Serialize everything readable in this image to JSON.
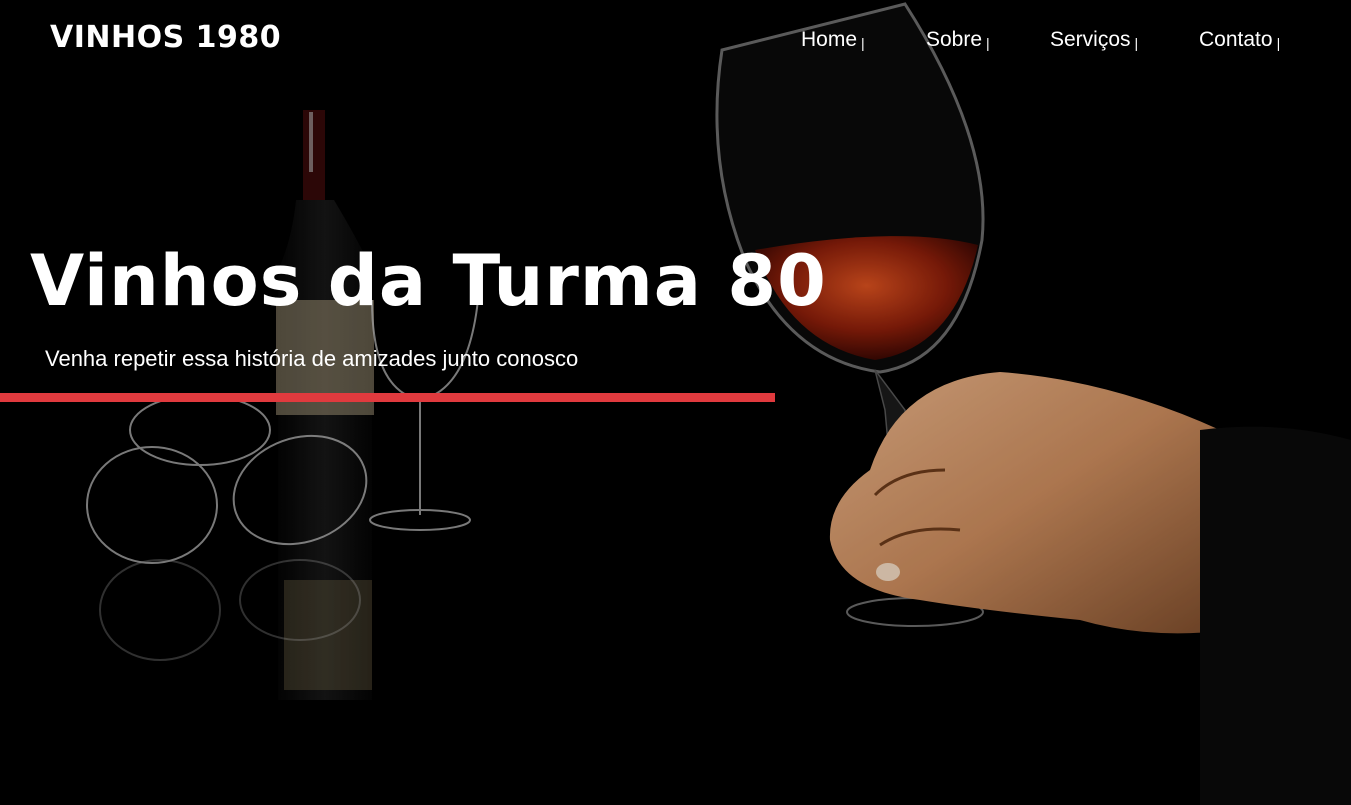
{
  "brand": {
    "logo_text": "VINHOS 1980"
  },
  "nav": {
    "items": [
      {
        "label": "Home",
        "separator": "|"
      },
      {
        "label": "Sobre",
        "separator": "|"
      },
      {
        "label": "Serviços",
        "separator": "|"
      },
      {
        "label": "Contato",
        "separator": "|"
      }
    ]
  },
  "hero": {
    "title": "Vinhos da Turma 80",
    "subtitle": "Venha repetir essa história de amizades junto conosco",
    "background_image": "wine-glasses-hand-photo"
  },
  "colors": {
    "background": "#000000",
    "text": "#ffffff",
    "accent": "#e03a3e",
    "wine": "#a82a10"
  }
}
